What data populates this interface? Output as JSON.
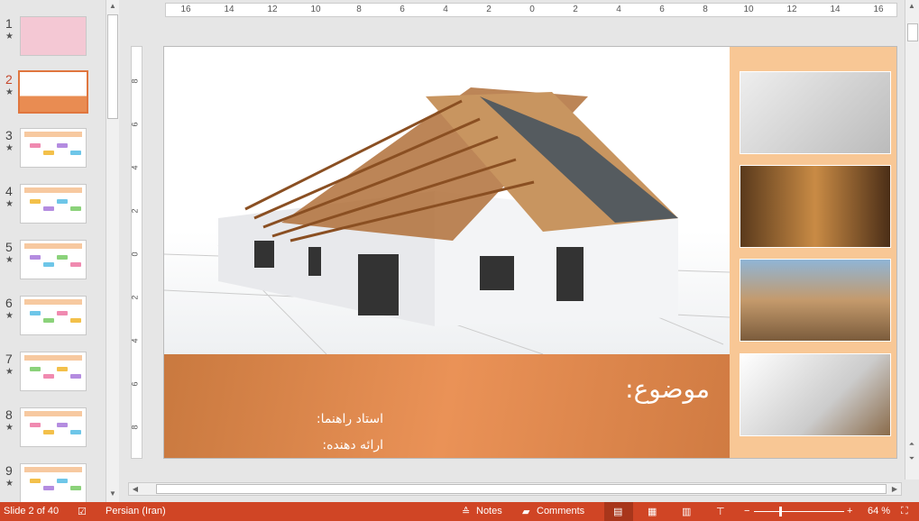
{
  "thumbnails": [
    {
      "n": "1"
    },
    {
      "n": "2",
      "selected": true
    },
    {
      "n": "3"
    },
    {
      "n": "4"
    },
    {
      "n": "5"
    },
    {
      "n": "6"
    },
    {
      "n": "7"
    },
    {
      "n": "8"
    },
    {
      "n": "9"
    }
  ],
  "ruler_h": [
    "16",
    "14",
    "12",
    "10",
    "8",
    "6",
    "4",
    "2",
    "0",
    "2",
    "4",
    "6",
    "8",
    "10",
    "12",
    "14",
    "16"
  ],
  "ruler_v": [
    "8",
    "6",
    "4",
    "2",
    "0",
    "2",
    "4",
    "6",
    "8"
  ],
  "slide": {
    "title": "موضوع:",
    "advisor": "استاد راهنما:",
    "presenter": "ارائه دهنده:"
  },
  "colors": {
    "accent": "#d04525",
    "band": "#ea9257",
    "side": "#f8c795"
  },
  "status": {
    "slide": "Slide 2 of 40",
    "language": "Persian (Iran)",
    "notes": "Notes",
    "comments": "Comments",
    "zoom": "64 %",
    "zoom_percent": 64
  }
}
